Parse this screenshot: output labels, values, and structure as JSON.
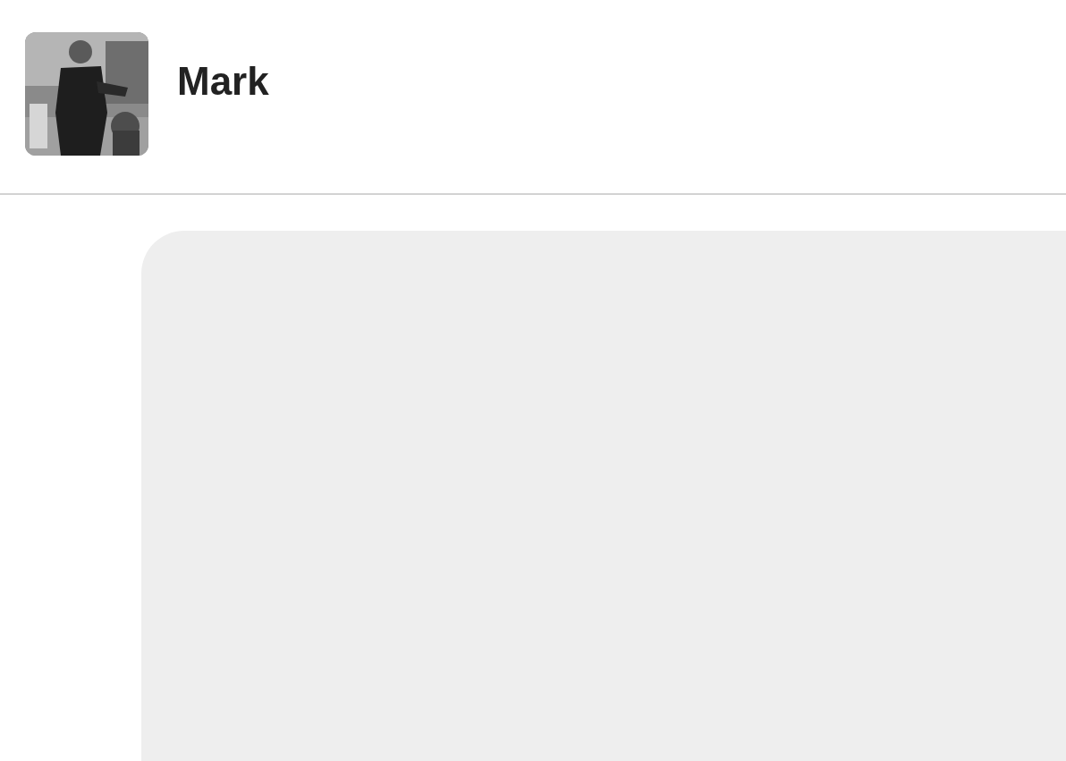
{
  "header": {
    "name": "Mark"
  }
}
